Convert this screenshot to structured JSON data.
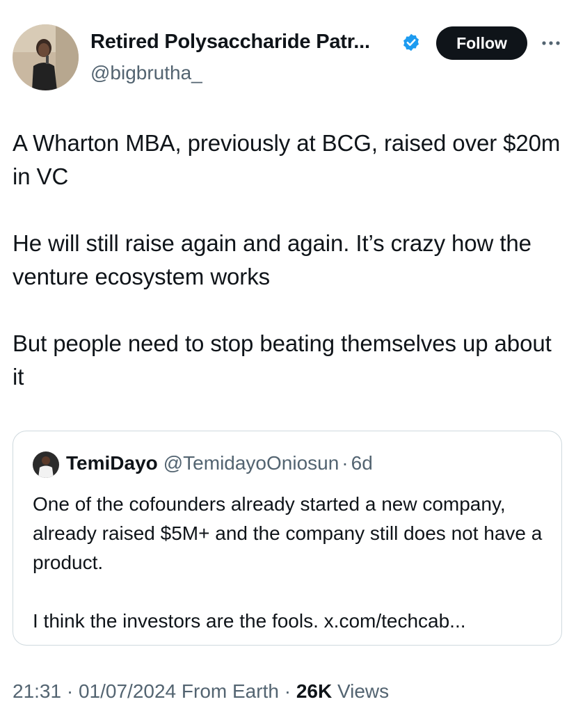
{
  "author": {
    "display_name": "Retired Polysaccharide Patr...",
    "handle": "@bigbrutha_",
    "verified_icon": "verified-badge-icon",
    "accent_color": "#1d9bf0"
  },
  "actions": {
    "follow_label": "Follow",
    "more_icon": "more-dots-icon"
  },
  "tweet": {
    "paragraphs": [
      "A Wharton MBA, previously at BCG, raised over $20m in VC",
      "He will still raise again and again. It’s crazy how the venture ecosystem works",
      "But people need to stop beating themselves up about it"
    ]
  },
  "quote": {
    "display_name": "TemiDayo",
    "handle": "@TemidayoOniosun",
    "separator": "·",
    "time": "6d",
    "paragraphs": [
      "One of the cofounders already started a new company, already raised $5M+ and the company still does not have a product.",
      "I think the investors are the fools. x.com/techcab..."
    ]
  },
  "meta": {
    "time": "21:31",
    "separator": "·",
    "date": "01/07/2024",
    "location": "From Earth",
    "views_count": "26K",
    "views_label": "Views"
  }
}
